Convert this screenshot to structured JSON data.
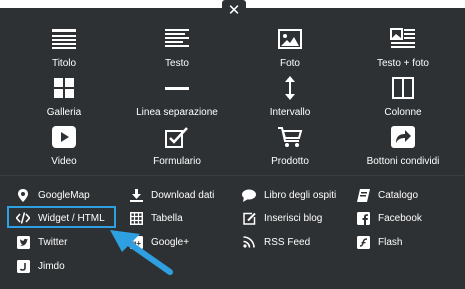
{
  "close": {
    "glyph": "✕"
  },
  "big": [
    {
      "label": "Titolo",
      "icon": "title-lines-icon"
    },
    {
      "label": "Testo",
      "icon": "text-lines-icon"
    },
    {
      "label": "Foto",
      "icon": "photo-icon"
    },
    {
      "label": "Testo + foto",
      "icon": "text-photo-icon"
    },
    {
      "label": "Galleria",
      "icon": "gallery-grid-icon"
    },
    {
      "label": "Linea separazione",
      "icon": "separator-line-icon"
    },
    {
      "label": "Intervallo",
      "icon": "spacer-arrows-icon"
    },
    {
      "label": "Colonne",
      "icon": "columns-icon"
    },
    {
      "label": "Video",
      "icon": "video-play-icon"
    },
    {
      "label": "Formulario",
      "icon": "form-checkbox-icon"
    },
    {
      "label": "Prodotto",
      "icon": "cart-icon"
    },
    {
      "label": "Bottoni condividi",
      "icon": "share-icon"
    }
  ],
  "small": [
    {
      "label": "GoogleMap",
      "icon": "map-pin-icon"
    },
    {
      "label": "Download dati",
      "icon": "download-icon"
    },
    {
      "label": "Libro degli ospiti",
      "icon": "speech-bubble-icon"
    },
    {
      "label": "Catalogo",
      "icon": "book-icon"
    },
    {
      "label": "Widget / HTML",
      "icon": "code-icon"
    },
    {
      "label": "Tabella",
      "icon": "table-icon"
    },
    {
      "label": "Inserisci blog",
      "icon": "edit-icon"
    },
    {
      "label": "Facebook",
      "icon": "facebook-icon"
    },
    {
      "label": "Twitter",
      "icon": "twitter-icon"
    },
    {
      "label": "Google+",
      "icon": "google-plus-icon"
    },
    {
      "label": "RSS Feed",
      "icon": "rss-icon"
    },
    {
      "label": "Flash",
      "icon": "flash-icon"
    },
    {
      "label": "Jimdo",
      "icon": "jimdo-icon"
    }
  ],
  "colors": {
    "panel": "#2e3133",
    "highlight": "#2e9fe0",
    "text": "#ffffff"
  }
}
